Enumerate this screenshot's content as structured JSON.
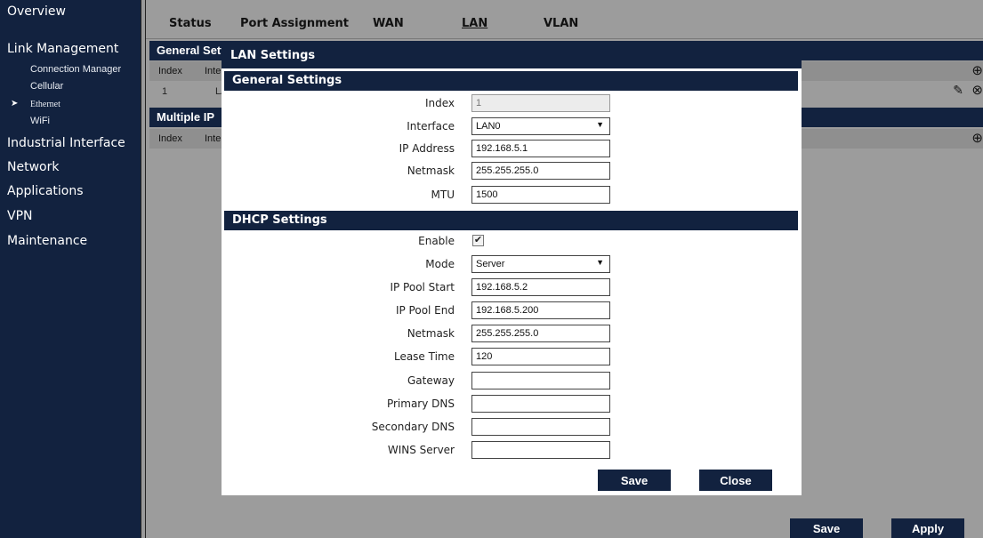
{
  "sidebar": {
    "items": [
      {
        "label": "Overview"
      },
      {
        "label": "Link Management"
      },
      {
        "label": "Industrial Interface"
      },
      {
        "label": "Network"
      },
      {
        "label": "Applications"
      },
      {
        "label": "VPN"
      },
      {
        "label": "Maintenance"
      }
    ],
    "sub_items": [
      {
        "label": "Connection Manager"
      },
      {
        "label": "Cellular"
      },
      {
        "label": "Ethernet"
      },
      {
        "label": "WiFi"
      }
    ]
  },
  "tabs": [
    "Status",
    "Port Assignment",
    "WAN",
    "LAN",
    "VLAN"
  ],
  "background": {
    "general_section": "General Settings",
    "multiple_ip_section": "Multiple IP",
    "col_index": "Index",
    "col_interface": "Interface",
    "row_index": "1",
    "row_interface": "LAN0"
  },
  "bottom": {
    "save": "Save",
    "apply": "Apply"
  },
  "modal": {
    "title": "LAN Settings",
    "general_title": "General Settings",
    "dhcp_title": "DHCP Settings",
    "labels": {
      "index": "Index",
      "interface": "Interface",
      "ip_address": "IP Address",
      "netmask": "Netmask",
      "mtu": "MTU",
      "enable": "Enable",
      "mode": "Mode",
      "ip_pool_start": "IP Pool Start",
      "ip_pool_end": "IP Pool End",
      "dhcp_netmask": "Netmask",
      "lease_time": "Lease Time",
      "gateway": "Gateway",
      "primary_dns": "Primary DNS",
      "secondary_dns": "Secondary DNS",
      "wins_server": "WINS Server"
    },
    "values": {
      "index": "1",
      "interface": "LAN0",
      "ip_address": "192.168.5.1",
      "netmask": "255.255.255.0",
      "mtu": "1500",
      "enable": true,
      "mode": "Server",
      "ip_pool_start": "192.168.5.2",
      "ip_pool_end": "192.168.5.200",
      "dhcp_netmask": "255.255.255.0",
      "lease_time": "120",
      "gateway": "",
      "primary_dns": "",
      "secondary_dns": "",
      "wins_server": ""
    },
    "save": "Save",
    "close": "Close"
  },
  "colors": {
    "navy": "#12223f",
    "overlay": "#9c9c9c"
  },
  "icons": {
    "add": "plus-circle-icon",
    "edit": "edit-icon",
    "delete": "delete-icon",
    "check": "checkmark-icon",
    "dropdown": "dropdown-caret-icon",
    "expand_arrow": "arrow-right-icon"
  }
}
